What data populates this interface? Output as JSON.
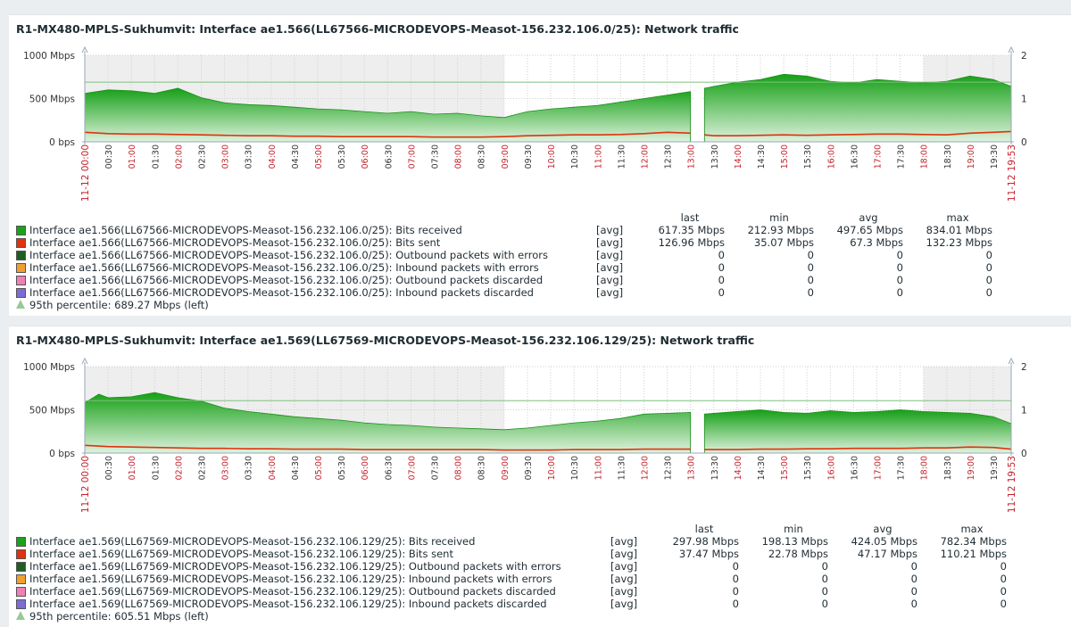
{
  "colors": {
    "received": "#1aa31a",
    "sent": "#e0320e",
    "out_err": "#1e5e23",
    "in_err": "#f0a030",
    "out_disc": "#ef7fb5",
    "in_disc": "#7b6dd4",
    "p95": "#98c998"
  },
  "graphs": [
    {
      "title": "R1-MX480-MPLS-Sukhumvit: Interface ae1.566(LL67566-MICRODEVOPS-Measot-156.232.106.0/25): Network traffic",
      "legend_headers": [
        "last",
        "min",
        "avg",
        "max"
      ],
      "items": [
        {
          "name": "Interface ae1.566(LL67566-MICRODEVOPS-Measot-156.232.106.0/25): Bits received",
          "func": "[avg]",
          "last": "617.35 Mbps",
          "min": "212.93 Mbps",
          "avg": "497.65 Mbps",
          "max": "834.01 Mbps",
          "color": "#1aa31a"
        },
        {
          "name": "Interface ae1.566(LL67566-MICRODEVOPS-Measot-156.232.106.0/25): Bits sent",
          "func": "[avg]",
          "last": "126.96 Mbps",
          "min": "35.07 Mbps",
          "avg": "67.3 Mbps",
          "max": "132.23 Mbps",
          "color": "#e0320e"
        },
        {
          "name": "Interface ae1.566(LL67566-MICRODEVOPS-Measot-156.232.106.0/25): Outbound packets with errors",
          "func": "[avg]",
          "last": "0",
          "min": "0",
          "avg": "0",
          "max": "0",
          "color": "#1e5e23"
        },
        {
          "name": "Interface ae1.566(LL67566-MICRODEVOPS-Measot-156.232.106.0/25): Inbound packets with errors",
          "func": "[avg]",
          "last": "0",
          "min": "0",
          "avg": "0",
          "max": "0",
          "color": "#f0a030"
        },
        {
          "name": "Interface ae1.566(LL67566-MICRODEVOPS-Measot-156.232.106.0/25): Outbound packets discarded",
          "func": "[avg]",
          "last": "0",
          "min": "0",
          "avg": "0",
          "max": "0",
          "color": "#ef7fb5"
        },
        {
          "name": "Interface ae1.566(LL67566-MICRODEVOPS-Measot-156.232.106.0/25): Inbound packets discarded",
          "func": "[avg]",
          "last": "0",
          "min": "0",
          "avg": "0",
          "max": "0",
          "color": "#7b6dd4"
        }
      ],
      "percentile": "95th percentile: 689.27 Mbps (left)"
    },
    {
      "title": "R1-MX480-MPLS-Sukhumvit: Interface ae1.569(LL67569-MICRODEVOPS-Measot-156.232.106.129/25): Network traffic",
      "legend_headers": [
        "last",
        "min",
        "avg",
        "max"
      ],
      "items": [
        {
          "name": "Interface ae1.569(LL67569-MICRODEVOPS-Measot-156.232.106.129/25): Bits received",
          "func": "[avg]",
          "last": "297.98 Mbps",
          "min": "198.13 Mbps",
          "avg": "424.05 Mbps",
          "max": "782.34 Mbps",
          "color": "#1aa31a"
        },
        {
          "name": "Interface ae1.569(LL67569-MICRODEVOPS-Measot-156.232.106.129/25): Bits sent",
          "func": "[avg]",
          "last": "37.47 Mbps",
          "min": "22.78 Mbps",
          "avg": "47.17 Mbps",
          "max": "110.21 Mbps",
          "color": "#e0320e"
        },
        {
          "name": "Interface ae1.569(LL67569-MICRODEVOPS-Measot-156.232.106.129/25): Outbound packets with errors",
          "func": "[avg]",
          "last": "0",
          "min": "0",
          "avg": "0",
          "max": "0",
          "color": "#1e5e23"
        },
        {
          "name": "Interface ae1.569(LL67569-MICRODEVOPS-Measot-156.232.106.129/25): Inbound packets with errors",
          "func": "[avg]",
          "last": "0",
          "min": "0",
          "avg": "0",
          "max": "0",
          "color": "#f0a030"
        },
        {
          "name": "Interface ae1.569(LL67569-MICRODEVOPS-Measot-156.232.106.129/25): Outbound packets discarded",
          "func": "[avg]",
          "last": "0",
          "min": "0",
          "avg": "0",
          "max": "0",
          "color": "#ef7fb5"
        },
        {
          "name": "Interface ae1.569(LL67569-MICRODEVOPS-Measot-156.232.106.129/25): Inbound packets discarded",
          "func": "[avg]",
          "last": "0",
          "min": "0",
          "avg": "0",
          "max": "0",
          "color": "#7b6dd4"
        }
      ],
      "percentile": "95th percentile: 605.51 Mbps (left)"
    }
  ],
  "chart_data": [
    {
      "type": "area",
      "title": "R1-MX480-MPLS-Sukhumvit: Interface ae1.566(LL67566-MICRODEVOPS-Measot-156.232.106.0/25): Network traffic",
      "y_left_ticks": [
        "0 bps",
        "500 Mbps",
        "1000 Mbps"
      ],
      "y_right_ticks": [
        "0",
        "1",
        "2"
      ],
      "ylim": [
        0,
        1000
      ],
      "x_labels": [
        "11-12 00:00",
        "00:30",
        "01:00",
        "01:30",
        "02:00",
        "02:30",
        "03:00",
        "03:30",
        "04:00",
        "04:30",
        "05:00",
        "05:30",
        "06:00",
        "06:30",
        "07:00",
        "07:30",
        "08:00",
        "08:30",
        "09:00",
        "09:30",
        "10:00",
        "10:30",
        "11:00",
        "11:30",
        "12:00",
        "12:30",
        "13:00",
        "13:30",
        "14:00",
        "14:30",
        "15:00",
        "15:30",
        "16:00",
        "16:30",
        "17:00",
        "17:30",
        "18:00",
        "18:30",
        "19:00",
        "19:30",
        "11-12 19:53"
      ],
      "x_hours": [
        0,
        0.5,
        1,
        1.5,
        2,
        2.5,
        3,
        3.5,
        4,
        4.5,
        5,
        5.5,
        6,
        6.5,
        7,
        7.5,
        8,
        8.5,
        9,
        9.5,
        10,
        10.5,
        11,
        11.5,
        12,
        12.5,
        13,
        13.5,
        14,
        14.5,
        15,
        15.5,
        16,
        16.5,
        17,
        17.5,
        18,
        18.5,
        19,
        19.5,
        19.883
      ],
      "x_domain": [
        0,
        19.883
      ],
      "night_shading": [
        [
          0,
          9
        ],
        [
          18,
          19.883
        ]
      ],
      "gap": [
        13.05,
        13.25
      ],
      "percentile_line": 689.27,
      "series": [
        {
          "name": "Bits received",
          "x": [
            0,
            0.5,
            1,
            1.5,
            2,
            2.5,
            3,
            3.5,
            4,
            4.5,
            5,
            5.5,
            6,
            6.5,
            7,
            7.5,
            8,
            8.5,
            9,
            9.5,
            10,
            10.5,
            11,
            11.5,
            12,
            12.5,
            13,
            13.3,
            13.5,
            14,
            14.5,
            15,
            15.5,
            16,
            16.5,
            17,
            17.5,
            18,
            18.5,
            19,
            19.5,
            19.883
          ],
          "values": [
            560,
            600,
            590,
            560,
            620,
            510,
            450,
            430,
            420,
            400,
            380,
            370,
            350,
            330,
            350,
            320,
            330,
            300,
            280,
            350,
            380,
            400,
            420,
            460,
            500,
            540,
            580,
            620,
            640,
            690,
            720,
            780,
            760,
            700,
            680,
            720,
            700,
            680,
            700,
            760,
            720,
            640
          ]
        },
        {
          "name": "Bits sent",
          "x": [
            0,
            0.5,
            1,
            1.5,
            2,
            2.5,
            3,
            3.5,
            4,
            4.5,
            5,
            5.5,
            6,
            6.5,
            7,
            7.5,
            8,
            8.5,
            9,
            9.5,
            10,
            10.5,
            11,
            11.5,
            12,
            12.5,
            13,
            13.3,
            13.5,
            14,
            14.5,
            15,
            15.5,
            16,
            16.5,
            17,
            17.5,
            18,
            18.5,
            19,
            19.5,
            19.883
          ],
          "values": [
            110,
            95,
            90,
            90,
            85,
            80,
            75,
            70,
            70,
            65,
            65,
            60,
            60,
            60,
            60,
            55,
            55,
            55,
            60,
            70,
            75,
            80,
            80,
            85,
            95,
            110,
            100,
            80,
            70,
            70,
            75,
            80,
            75,
            80,
            85,
            90,
            90,
            85,
            80,
            100,
            110,
            120
          ]
        }
      ]
    },
    {
      "type": "area",
      "title": "R1-MX480-MPLS-Sukhumvit: Interface ae1.569(LL67569-MICRODEVOPS-Measot-156.232.106.129/25): Network traffic",
      "y_left_ticks": [
        "0 bps",
        "500 Mbps",
        "1000 Mbps"
      ],
      "y_right_ticks": [
        "0",
        "1",
        "2"
      ],
      "ylim": [
        0,
        1000
      ],
      "x_labels": [
        "11-12 00:00",
        "00:30",
        "01:00",
        "01:30",
        "02:00",
        "02:30",
        "03:00",
        "03:30",
        "04:00",
        "04:30",
        "05:00",
        "05:30",
        "06:00",
        "06:30",
        "07:00",
        "07:30",
        "08:00",
        "08:30",
        "09:00",
        "09:30",
        "10:00",
        "10:30",
        "11:00",
        "11:30",
        "12:00",
        "12:30",
        "13:00",
        "13:30",
        "14:00",
        "14:30",
        "15:00",
        "15:30",
        "16:00",
        "16:30",
        "17:00",
        "17:30",
        "18:00",
        "18:30",
        "19:00",
        "19:30",
        "11-12 19:53"
      ],
      "x_hours": [
        0,
        0.5,
        1,
        1.5,
        2,
        2.5,
        3,
        3.5,
        4,
        4.5,
        5,
        5.5,
        6,
        6.5,
        7,
        7.5,
        8,
        8.5,
        9,
        9.5,
        10,
        10.5,
        11,
        11.5,
        12,
        12.5,
        13,
        13.5,
        14,
        14.5,
        15,
        15.5,
        16,
        16.5,
        17,
        17.5,
        18,
        18.5,
        19,
        19.5,
        19.883
      ],
      "x_domain": [
        0,
        19.883
      ],
      "night_shading": [
        [
          0,
          9
        ],
        [
          18,
          19.883
        ]
      ],
      "gap": [
        13.05,
        13.25
      ],
      "percentile_line": 605.51,
      "series": [
        {
          "name": "Bits received",
          "x": [
            0,
            0.3,
            0.5,
            1,
            1.5,
            2,
            2.5,
            3,
            3.5,
            4,
            4.5,
            5,
            5.5,
            6,
            6.5,
            7,
            7.5,
            8,
            8.5,
            9,
            9.5,
            10,
            10.5,
            11,
            11.5,
            12,
            12.5,
            13,
            13.3,
            13.5,
            14,
            14.5,
            15,
            15.5,
            16,
            16.5,
            17,
            17.5,
            18,
            18.5,
            19,
            19.5,
            19.883
          ],
          "values": [
            580,
            680,
            640,
            650,
            700,
            640,
            600,
            520,
            480,
            450,
            420,
            400,
            380,
            350,
            330,
            320,
            300,
            290,
            280,
            270,
            290,
            320,
            350,
            370,
            400,
            450,
            460,
            470,
            450,
            460,
            480,
            500,
            470,
            460,
            490,
            470,
            480,
            500,
            480,
            470,
            460,
            420,
            340
          ]
        },
        {
          "name": "Bits sent",
          "x": [
            0,
            0.5,
            1,
            1.5,
            2,
            2.5,
            3,
            3.5,
            4,
            4.5,
            5,
            5.5,
            6,
            6.5,
            7,
            7.5,
            8,
            8.5,
            9,
            9.5,
            10,
            10.5,
            11,
            11.5,
            12,
            12.5,
            13,
            13.3,
            13.5,
            14,
            14.5,
            15,
            15.5,
            16,
            16.5,
            17,
            17.5,
            18,
            18.5,
            19,
            19.5,
            19.883
          ],
          "values": [
            90,
            75,
            70,
            65,
            60,
            55,
            55,
            50,
            50,
            45,
            45,
            45,
            40,
            40,
            40,
            40,
            40,
            40,
            35,
            35,
            35,
            40,
            40,
            40,
            45,
            45,
            45,
            40,
            40,
            40,
            45,
            45,
            50,
            50,
            55,
            55,
            55,
            60,
            60,
            70,
            65,
            45
          ]
        }
      ]
    }
  ]
}
